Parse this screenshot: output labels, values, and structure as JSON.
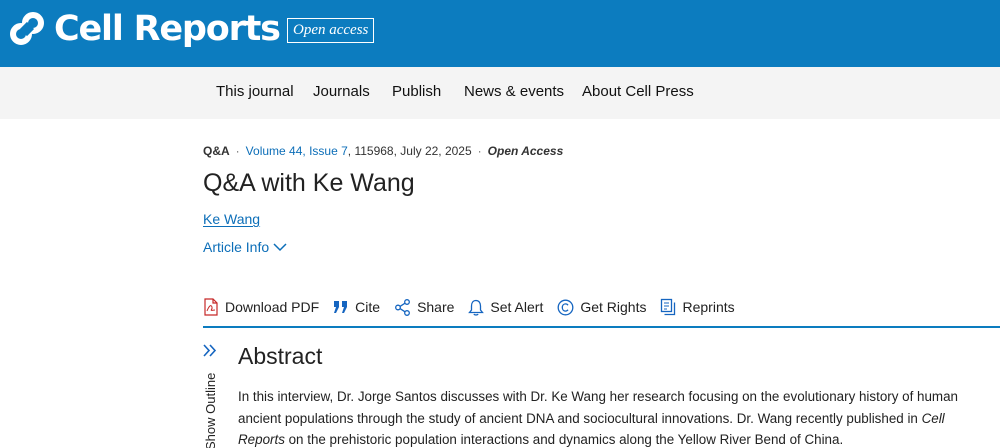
{
  "brand": {
    "name": "Cell Reports",
    "badge": "Open access",
    "color": "#0c7cbf"
  },
  "nav": {
    "items": [
      "This journal",
      "Journals",
      "Publish",
      "News & events",
      "About Cell Press"
    ]
  },
  "article": {
    "type": "Q&A",
    "volume": "Volume 44",
    "issue": "Issue 7",
    "article_number": "115968",
    "date": "July 22, 2025",
    "access": "Open Access",
    "title": "Q&A with Ke Wang",
    "author": "Ke Wang",
    "article_info": "Article Info"
  },
  "toolbar": {
    "items": [
      {
        "label": "Download PDF",
        "icon": "pdf-icon"
      },
      {
        "label": "Cite",
        "icon": "quote-icon"
      },
      {
        "label": "Share",
        "icon": "share-icon"
      },
      {
        "label": "Set Alert",
        "icon": "bell-icon"
      },
      {
        "label": "Get Rights",
        "icon": "copyright-icon"
      },
      {
        "label": "Reprints",
        "icon": "reprints-icon"
      }
    ]
  },
  "outline": {
    "label": "Show Outline"
  },
  "abstract": {
    "heading": "Abstract",
    "lines": [
      "In this interview, Dr. Jorge Santos discusses with Dr. Ke Wang her research focusing on the evolutionary history of human",
      "ancient populations through the study of ancient DNA and sociocultural innovations. Dr. Wang recently published in ",
      "Cell",
      "Reports",
      " on the prehistoric population interactions and dynamics along the Yellow River Bend of China."
    ]
  },
  "colors": {
    "link": "#0c6eb8",
    "nav_bg": "#f4f4f4",
    "rule": "#0c7cbf"
  }
}
